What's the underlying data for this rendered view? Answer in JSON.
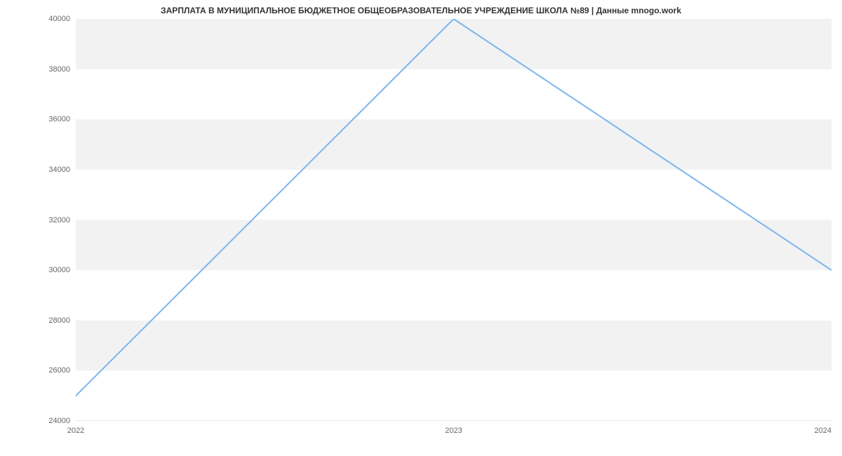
{
  "chart_data": {
    "type": "line",
    "title": "ЗАРПЛАТА В МУНИЦИПАЛЬНОЕ БЮДЖЕТНОЕ ОБЩЕОБРАЗОВАТЕЛЬНОЕ УЧРЕЖДЕНИЕ ШКОЛА №89 | Данные mnogo.work",
    "x": [
      "2022",
      "2023",
      "2024"
    ],
    "values": [
      25000,
      40000,
      30000
    ],
    "xlabel": "",
    "ylabel": "",
    "y_ticks": [
      24000,
      26000,
      28000,
      30000,
      32000,
      34000,
      36000,
      38000,
      40000
    ],
    "ylim": [
      24000,
      40000
    ],
    "line_color": "#7cb5ec"
  }
}
